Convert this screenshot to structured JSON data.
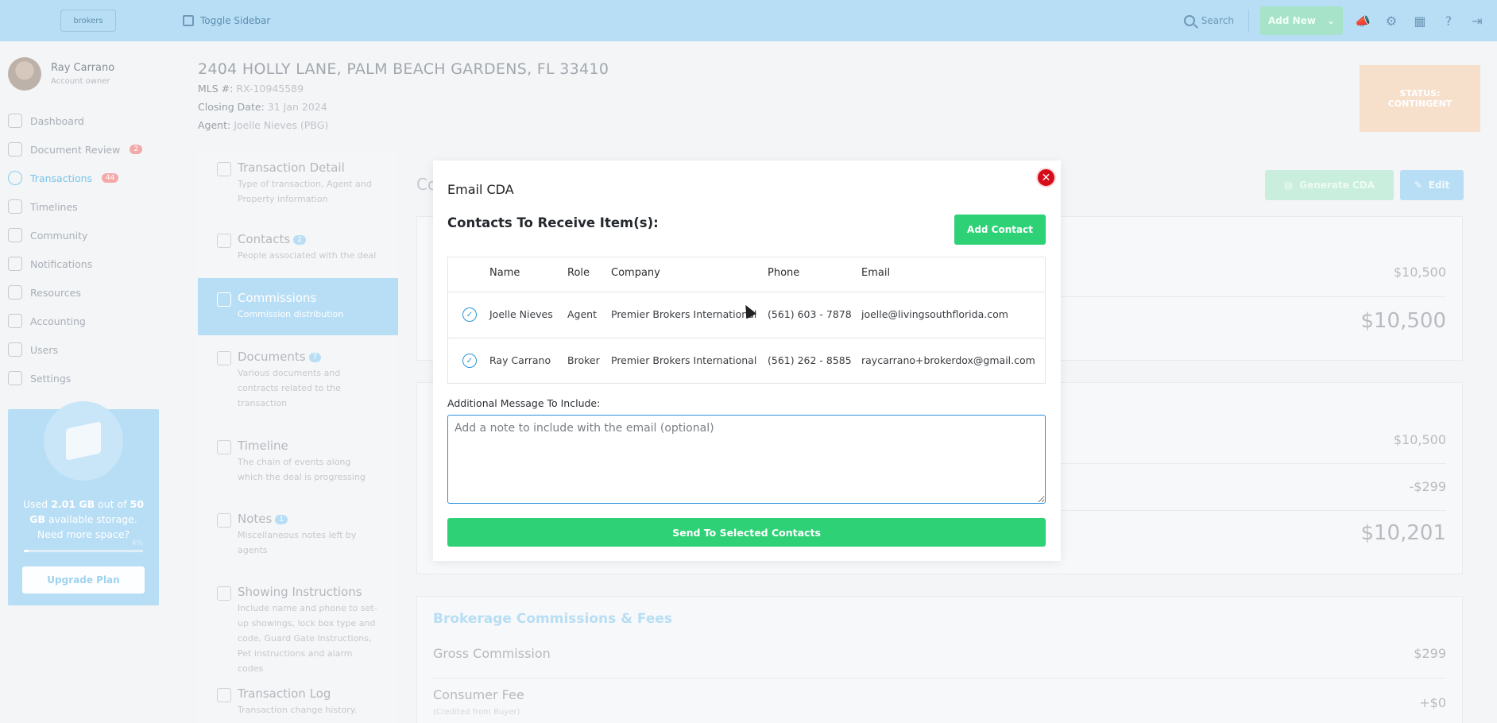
{
  "topbar": {
    "logo_text": "brokers",
    "toggle_sidebar": "Toggle Sidebar",
    "search": "Search",
    "add_new": "Add New"
  },
  "user": {
    "name": "Ray Carrano",
    "role": "Account owner"
  },
  "sidebar": {
    "items": [
      {
        "label": "Dashboard",
        "icon": "dashboard-icon"
      },
      {
        "label": "Document Review",
        "badge": "2",
        "icon": "document-review-icon"
      },
      {
        "label": "Transactions",
        "badge": "44",
        "icon": "dollar-icon",
        "active": true
      },
      {
        "label": "Timelines",
        "icon": "timeline-icon"
      },
      {
        "label": "Community",
        "icon": "community-icon"
      },
      {
        "label": "Notifications",
        "icon": "bell-icon"
      },
      {
        "label": "Resources",
        "icon": "folder-icon"
      },
      {
        "label": "Accounting",
        "icon": "accounting-icon"
      },
      {
        "label": "Users",
        "icon": "user-icon"
      },
      {
        "label": "Settings",
        "icon": "gear-icon"
      }
    ],
    "storage": {
      "used": "2.01 GB",
      "total": "50",
      "line1_a": "Used ",
      "line1_b": " out of ",
      "line2": "GB",
      "line2_rest": " available storage.",
      "line3": "Need more space?",
      "percent_label": "4%",
      "percent": 4,
      "upgrade": "Upgrade Plan"
    }
  },
  "header": {
    "address": "2404 HOLLY LANE, PALM BEACH GARDENS, FL 33410",
    "mls_label": "MLS #:",
    "mls_value": "RX-10945589",
    "closing_label": "Closing Date:",
    "closing_value": "31 Jan 2024",
    "agent_label": "Agent:",
    "agent_value": "Joelle Nieves (PBG)",
    "status_label": "STATUS:",
    "status_value": "CONTINGENT"
  },
  "tabs": [
    {
      "title": "Transaction Detail",
      "desc": "Type of transaction, Agent and Property information"
    },
    {
      "title": "Contacts",
      "badge": "2",
      "desc": "People associated with the deal"
    },
    {
      "title": "Commissions",
      "desc": "Commission distribution",
      "active": true
    },
    {
      "title": "Documents",
      "badge": "7",
      "desc": "Various documents and contracts related to the transaction"
    },
    {
      "title": "Timeline",
      "desc": "The chain of events along which the deal is progressing"
    },
    {
      "title": "Notes",
      "badge": "1",
      "desc": "Miscellaneous notes left by agents"
    },
    {
      "title": "Showing Instructions",
      "desc": "Include name and phone to set-up showings, lock box type and code, Guard Gate Instructions, Pet instructions and alarm codes"
    },
    {
      "title": "Transaction Log",
      "desc": "Transaction change history."
    }
  ],
  "main": {
    "heading_partial": "Co",
    "generate_cda": "Generate CDA",
    "edit": "Edit",
    "card1": {
      "value1": "$10,500",
      "value2": "$10,500"
    },
    "card2": {
      "value1": "$10,500",
      "value2": "-$299",
      "value3": "$10,201"
    },
    "card3": {
      "title": "Brokerage Commissions & Fees",
      "gross_label": "Gross Commission",
      "gross_value": "$299",
      "consumer_label": "Consumer Fee",
      "consumer_sub": "(Credited from Buyer)",
      "consumer_value": "+$0"
    }
  },
  "modal": {
    "title": "Email CDA",
    "subtitle": "Contacts To Receive Item(s):",
    "add_contact": "Add Contact",
    "columns": [
      "Name",
      "Role",
      "Company",
      "Phone",
      "Email"
    ],
    "rows": [
      {
        "name": "Joelle Nieves",
        "role": "Agent",
        "company": "Premier Brokers International",
        "phone": "(561) 603 - 7878",
        "email": "joelle@livingsouthflorida.com",
        "checked": true
      },
      {
        "name": "Ray Carrano",
        "role": "Broker",
        "company": "Premier Brokers International",
        "phone": "(561) 262 - 8585",
        "email": "raycarrano+brokerdox@gmail.com",
        "checked": true
      }
    ],
    "message_label": "Additional Message To Include:",
    "message_placeholder": "Add a note to include with the email (optional)",
    "message_value": "",
    "send": "Send To Selected Contacts"
  }
}
